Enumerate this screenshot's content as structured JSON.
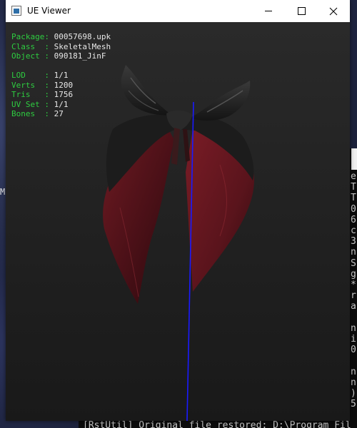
{
  "window": {
    "title": "UE Viewer",
    "controls": [
      "minimize",
      "maximize",
      "close"
    ]
  },
  "info": {
    "rows": [
      {
        "label": "Package:",
        "value": "00057698.upk"
      },
      {
        "label": "Class  :",
        "value": "SkeletalMesh"
      },
      {
        "label": "Object :",
        "value": "090181_JinF"
      }
    ],
    "stats": [
      {
        "label": "LOD    :",
        "value": "1/1"
      },
      {
        "label": "Verts  :",
        "value": "1200"
      },
      {
        "label": "Tris   :",
        "value": "1756"
      },
      {
        "label": "UV Set :",
        "value": "1/1"
      },
      {
        "label": "Bones  :",
        "value": "27"
      }
    ]
  },
  "background": {
    "side_letter": "M",
    "console_lines": [
      "e",
      "T",
      "T",
      "0",
      "6",
      "c",
      "3",
      "n",
      "S",
      "g",
      "*",
      "r",
      "a",
      "",
      "n",
      "i",
      "0",
      "",
      "n",
      "n",
      ")",
      "5"
    ],
    "console_bottom": "[RstUtil] Original file restored: D:\\Program Fil"
  },
  "colors": {
    "label_green": "#2ecc40",
    "value_white": "#e8e8e8",
    "bone_axis_blue": "#1a1aff",
    "cape_red": "#5a141a"
  }
}
